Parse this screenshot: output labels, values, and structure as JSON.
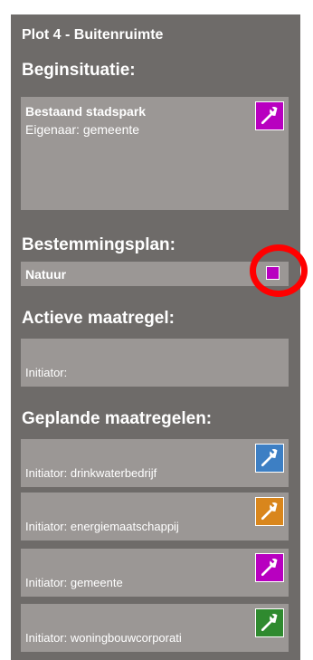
{
  "panel": {
    "title": "Plot 4 - Buitenruimte"
  },
  "beginsituatie": {
    "heading": "Beginsituatie:",
    "name": "Bestaand stadspark",
    "owner": "Eigenaar: gemeente",
    "icon": "wrench-icon",
    "color": "#b800c0"
  },
  "bestemmingsplan": {
    "heading": "Bestemmingsplan:",
    "value": "Natuur",
    "color": "#b800c0"
  },
  "actieve_maatregel": {
    "heading": "Actieve maatregel:",
    "initiator": "Initiator:"
  },
  "geplande_maatregelen": {
    "heading": "Geplande maatregelen:",
    "items": [
      {
        "initiator": "Initiator: drinkwaterbedrijf",
        "color": "#3d7fc4",
        "icon": "wrench-icon"
      },
      {
        "initiator": "Initiator: energiemaatschappij",
        "color": "#d9861c",
        "icon": "wrench-icon"
      },
      {
        "initiator": "Initiator: gemeente",
        "color": "#b800c0",
        "icon": "wrench-icon"
      },
      {
        "initiator": "Initiator: woningbouwcorporati",
        "color": "#2f8a2f",
        "icon": "wrench-icon"
      }
    ]
  }
}
